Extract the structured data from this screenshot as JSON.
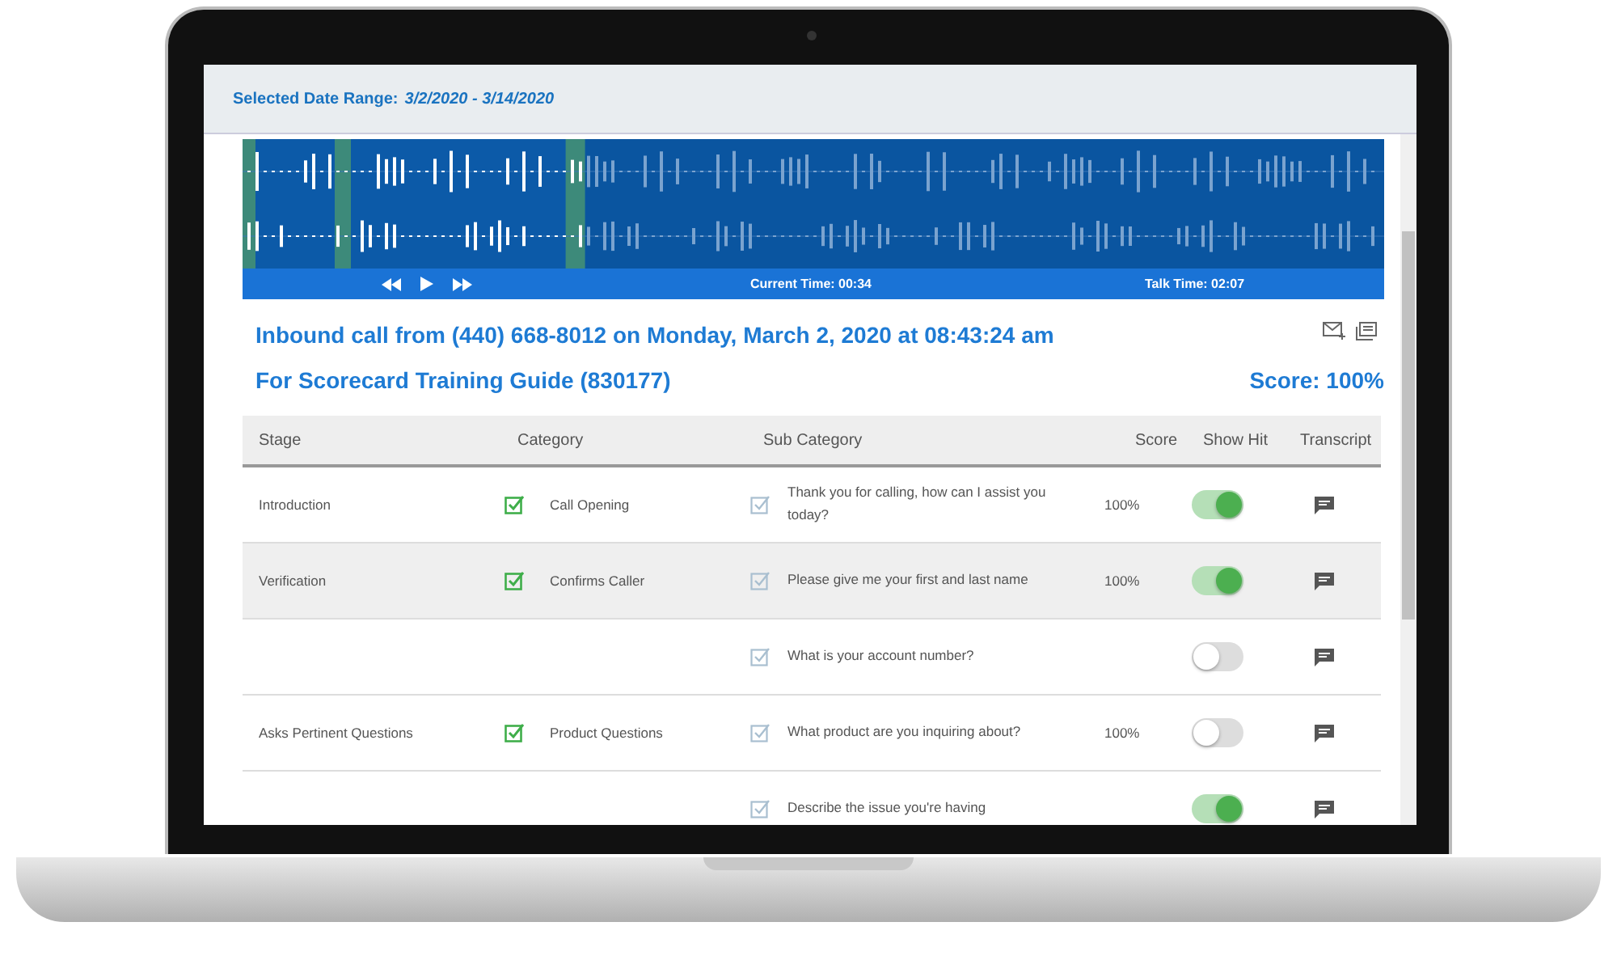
{
  "header": {
    "label": "Selected Date Range:",
    "value": "3/2/2020 - 3/14/2020"
  },
  "player": {
    "current_time": "Current Time: 00:34",
    "talk_time": "Talk Time: 02:07",
    "level": 0.3
  },
  "call": {
    "title": "Inbound call from (440) 668-8012 on Monday, March 2, 2020 at 08:43:24 am",
    "guide": "For Scorecard Training Guide (830177)",
    "score": "Score: 100%"
  },
  "table": {
    "columns": [
      "Stage",
      "Category",
      "Sub Category",
      "Score",
      "Show Hit",
      "Transcript"
    ],
    "rows": [
      {
        "stage": "Introduction",
        "category": "Call Opening",
        "category_checked": true,
        "sub_checked": true,
        "sub_category": "Thank you for calling, how can I assist you today?",
        "score": "100%",
        "show_hit": true,
        "selected": false
      },
      {
        "stage": "Verification",
        "category": "Confirms Caller",
        "category_checked": true,
        "sub_checked": true,
        "sub_category": "Please give me your first and last name",
        "score": "100%",
        "show_hit": true,
        "selected": true
      },
      {
        "sub_checked": true,
        "sub_category": "What is your account number?",
        "show_hit": false,
        "selected": false
      },
      {
        "stage": "Asks Pertinent Questions",
        "category": "Product Questions",
        "category_checked": true,
        "sub_checked": true,
        "sub_category": "What product are you inquiring about?",
        "score": "100%",
        "show_hit": false,
        "selected": false
      },
      {
        "sub_checked": true,
        "sub_category": "Describe the issue you're having",
        "show_hit": true,
        "selected": false
      }
    ]
  }
}
